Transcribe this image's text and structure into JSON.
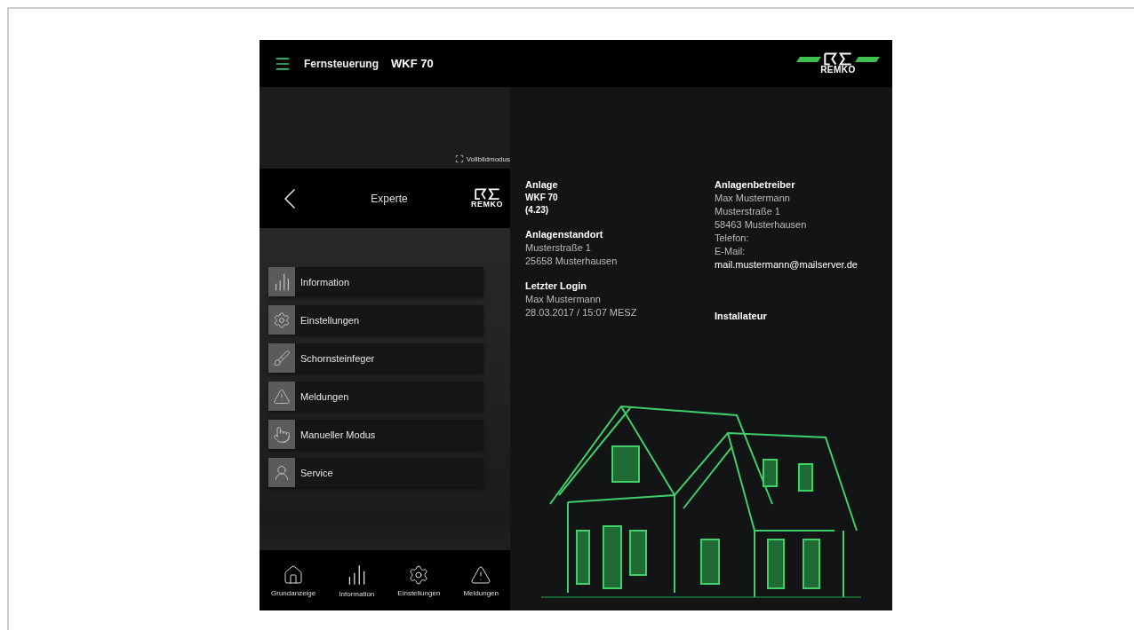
{
  "header": {
    "title": "Fernsteuerung",
    "device": "WKF 70",
    "logo_text": "REMKO"
  },
  "fullscreen_link": "Vollbildmodus",
  "sidebar": {
    "title": "Experte",
    "logo_text": "REMKO",
    "items": [
      {
        "label": "Information"
      },
      {
        "label": "Einstellungen"
      },
      {
        "label": "Schornsteinfeger"
      },
      {
        "label": "Meldungen"
      },
      {
        "label": "Manueller Modus"
      },
      {
        "label": "Service"
      }
    ]
  },
  "bottom_nav": [
    {
      "label": "Grundanzeige"
    },
    {
      "label": "Information"
    },
    {
      "label": "Einstellungen"
    },
    {
      "label": "Meldungen"
    }
  ],
  "info": {
    "left": [
      {
        "heading": "Anlage",
        "lines": [
          "WKF 70",
          "(4.23)"
        ],
        "emphasis": true
      },
      {
        "heading": "Anlagenstandort",
        "lines": [
          "Musterstraße 1",
          "25658 Musterhausen"
        ],
        "emphasis": false
      },
      {
        "heading": "Letzter Login",
        "lines": [
          "Max Mustermann",
          "28.03.2017 / 15:07 MESZ"
        ],
        "emphasis": false
      }
    ],
    "right": [
      {
        "heading": "Anlagenbetreiber",
        "lines": [
          "Max Mustermann",
          "Musterstraße 1",
          "58463 Musterhausen",
          "Telefon:",
          "E-Mail:"
        ],
        "email": "mail.mustermann@mailserver.de"
      },
      {
        "heading": "Installateur"
      }
    ]
  }
}
